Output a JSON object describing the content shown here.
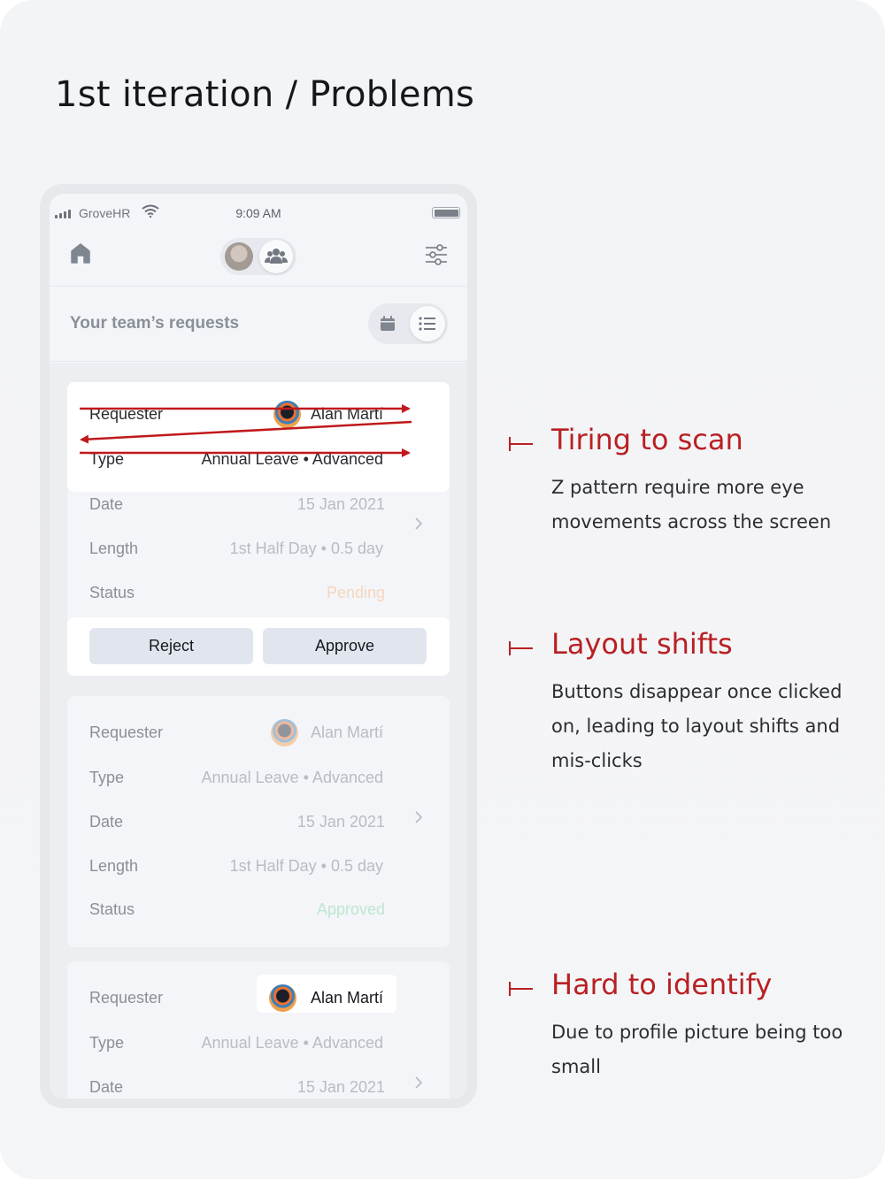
{
  "page": {
    "title": "1st iteration / Problems"
  },
  "phone": {
    "status_bar": {
      "carrier": "GroveHR",
      "time": "9:09 AM"
    },
    "nav": {
      "home_icon": "home-icon",
      "team_icon": "team-icon",
      "filter_icon": "sliders-icon"
    },
    "header": {
      "title": "Your team’s requests",
      "calendar_icon": "calendar-icon",
      "list_icon": "list-icon"
    },
    "cards": [
      {
        "requester_label": "Requester",
        "requester": "Alan Martí",
        "type_label": "Type",
        "type": "Annual Leave • Advanced",
        "date_label": "Date",
        "date": "15 Jan 2021",
        "length_label": "Length",
        "length": "1st Half Day • 0.5 day",
        "status_label": "Status",
        "status": "Pending",
        "reject_label": "Reject",
        "approve_label": "Approve"
      },
      {
        "requester_label": "Requester",
        "requester": "Alan Martí",
        "type_label": "Type",
        "type": "Annual Leave • Advanced",
        "date_label": "Date",
        "date": "15 Jan 2021",
        "length_label": "Length",
        "length": "1st Half Day • 0.5 day",
        "status_label": "Status",
        "status": "Approved"
      },
      {
        "requester_label": "Requester",
        "requester": "Alan Martí",
        "type_label": "Type",
        "type": "Annual Leave • Advanced",
        "date_label": "Date",
        "date": "15 Jan 2021"
      }
    ]
  },
  "annotations": [
    {
      "title": "Tiring to scan",
      "body": "Z pattern require more eye movements across the screen"
    },
    {
      "title": "Layout shifts",
      "body": "Buttons disappear once clicked on, leading to layout shifts and mis-clicks"
    },
    {
      "title": "Hard to identify",
      "body": "Due to profile picture being too small"
    }
  ],
  "colors": {
    "accent": "#b82023",
    "pending": "#f6d6bd",
    "approved": "#bfe6cf",
    "button": "#e1e6ee"
  }
}
